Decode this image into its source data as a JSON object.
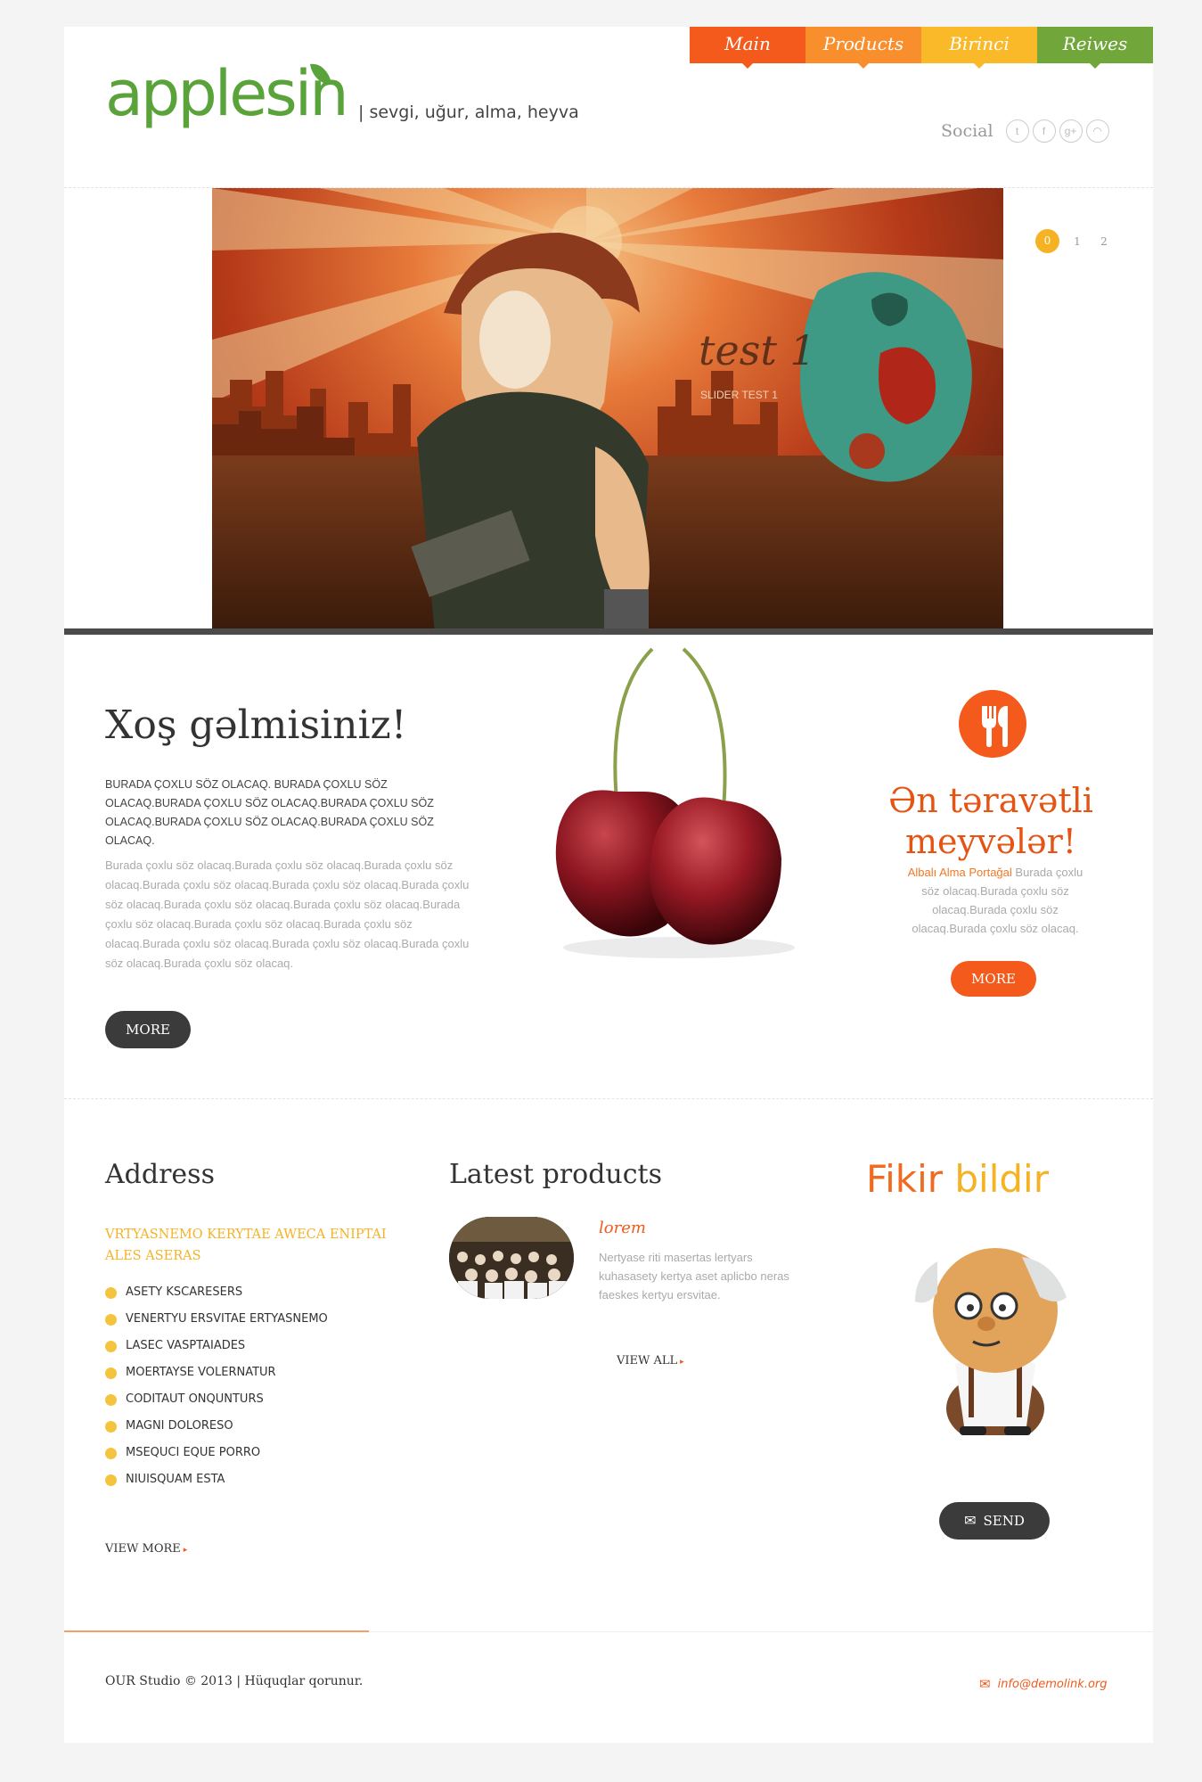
{
  "colors": {
    "nav_main": "#f35a1b",
    "nav_products": "#f98e2d",
    "nav_birinci": "#f9b928",
    "nav_reiwes": "#70a63a",
    "accent_orange": "#f35a1b",
    "accent_yellow": "#f5b324",
    "brand_green": "#5aa33b"
  },
  "nav": {
    "items": [
      {
        "label": "Main"
      },
      {
        "label": "Products"
      },
      {
        "label": "Birinci"
      },
      {
        "label": "Reiwes"
      }
    ]
  },
  "header": {
    "logo_text": "applesin",
    "tagline": "| sevgi, uğur, alma, heyva",
    "social_label": "Social",
    "social_icons": [
      "twitter-icon",
      "facebook-icon",
      "google-plus-icon",
      "rss-icon"
    ]
  },
  "slider": {
    "title": "test 1",
    "caption": "SLIDER TEST 1",
    "pages": [
      "0",
      "1",
      "2"
    ],
    "active_page": "0"
  },
  "welcome": {
    "title": "Xoş gəlmisiniz!",
    "upper_text": "BURADA ÇOXLU SÖZ OLACAQ. BURADA ÇOXLU SÖZ OLACAQ.BURADA ÇOXLU SÖZ OLACAQ.BURADA ÇOXLU SÖZ OLACAQ.BURADA ÇOXLU SÖZ OLACAQ.BURADA ÇOXLU SÖZ OLACAQ.",
    "body_text": "Burada çoxlu söz olacaq.Burada çoxlu söz olacaq.Burada çoxlu söz olacaq.Burada çoxlu söz olacaq.Burada çoxlu söz olacaq.Burada çoxlu söz olacaq.Burada çoxlu söz olacaq.Burada çoxlu söz olacaq.Burada çoxlu söz olacaq.Burada çoxlu söz olacaq.Burada çoxlu söz olacaq.Burada çoxlu söz olacaq.Burada çoxlu söz olacaq.Burada çoxlu söz olacaq.Burada çoxlu söz olacaq.",
    "more_label": "MORE"
  },
  "fresh": {
    "title_line1": "Ən təravətli",
    "title_line2": "meyvələr!",
    "highlight": "Albalı Alma Portağal",
    "text": " Burada çoxlu söz olacaq.Burada çoxlu söz olacaq.Burada çoxlu söz olacaq.Burada çoxlu söz olacaq.",
    "more_label": "MORE"
  },
  "address": {
    "title": "Address",
    "subtitle": "VRTYASNEMO KERYTAE AWECA ENIPTAI ALES ASERAS",
    "items": [
      "ASETY KSCARESERS",
      "VENERTYU ERSVITAE ERTYASNEMO",
      "LASEC VASPTAIADES",
      "MOERTAYSE VOLERNATUR",
      "CODITAUT ONQUNTURS",
      "MAGNI DOLORESO",
      "MSEQUCI EQUE PORRO",
      "NIUISQUAM ESTA"
    ],
    "view_more": "VIEW MORE"
  },
  "products": {
    "title": "Latest products",
    "item_name": "lorem",
    "item_text": "Nertyase riti masertas lertyars kuhasasety kertya aset aplicbo neras faeskes kertyu ersvitae.",
    "view_all": "VIEW ALL"
  },
  "feedback": {
    "title_part1": "Fikir",
    "title_part2": "bildir",
    "send_label": "SEND"
  },
  "footer": {
    "copyright": "OUR Studio © 2013 | Hüquqlar qorunur.",
    "email": "info@demolink.org"
  }
}
